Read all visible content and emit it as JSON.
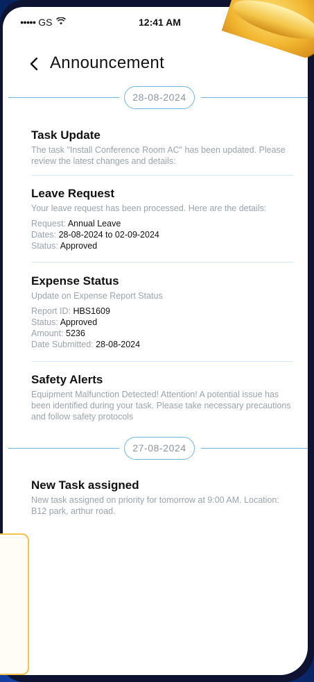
{
  "status_bar": {
    "carrier": "GS",
    "signal_dots": "●●●●●",
    "time": "12:41 AM"
  },
  "header": {
    "title": "Announcement"
  },
  "sections": [
    {
      "date": "28-08-2024",
      "items": [
        {
          "title": "Task Update",
          "description": "The task \"Install Conference Room AC\" has been updated. Please review the latest changes and details:"
        },
        {
          "title": "Leave Request",
          "description": "Your leave request has been processed. Here are the details:",
          "details": [
            {
              "label": "Request: ",
              "value": "Annual Leave"
            },
            {
              "label": "Dates: ",
              "value": "28-08-2024 to 02-09-2024"
            },
            {
              "label": "Status: ",
              "value": "Approved"
            }
          ]
        },
        {
          "title": "Expense Status",
          "description": "Update on Expense Report Status",
          "details": [
            {
              "label": "Report ID: ",
              "value": "HBS1609"
            },
            {
              "label": "Status: ",
              "value": "Approved"
            },
            {
              "label": "Amount: ",
              "value": "5236"
            },
            {
              "label": "Date Submitted: ",
              "value": "28-08-2024"
            }
          ]
        },
        {
          "title": "Safety Alerts",
          "description": "Equipment Malfunction Detected! Attention! A potential issue has been identified during your task. Please take necessary precautions and follow safety protocols"
        }
      ]
    },
    {
      "date": "27-08-2024",
      "items": [
        {
          "title": "New Task assigned",
          "description": "New task assigned on priority for tomorrow at 9:00 AM. Location: B12 park, arthur road."
        }
      ]
    }
  ],
  "icons": {
    "back": "chevron-left-icon",
    "wifi": "wifi-icon",
    "bell": "bell-icon"
  },
  "colors": {
    "accent": "#6ab7e6",
    "muted_text": "#9aa3ad",
    "background": "#0a2a6e"
  }
}
